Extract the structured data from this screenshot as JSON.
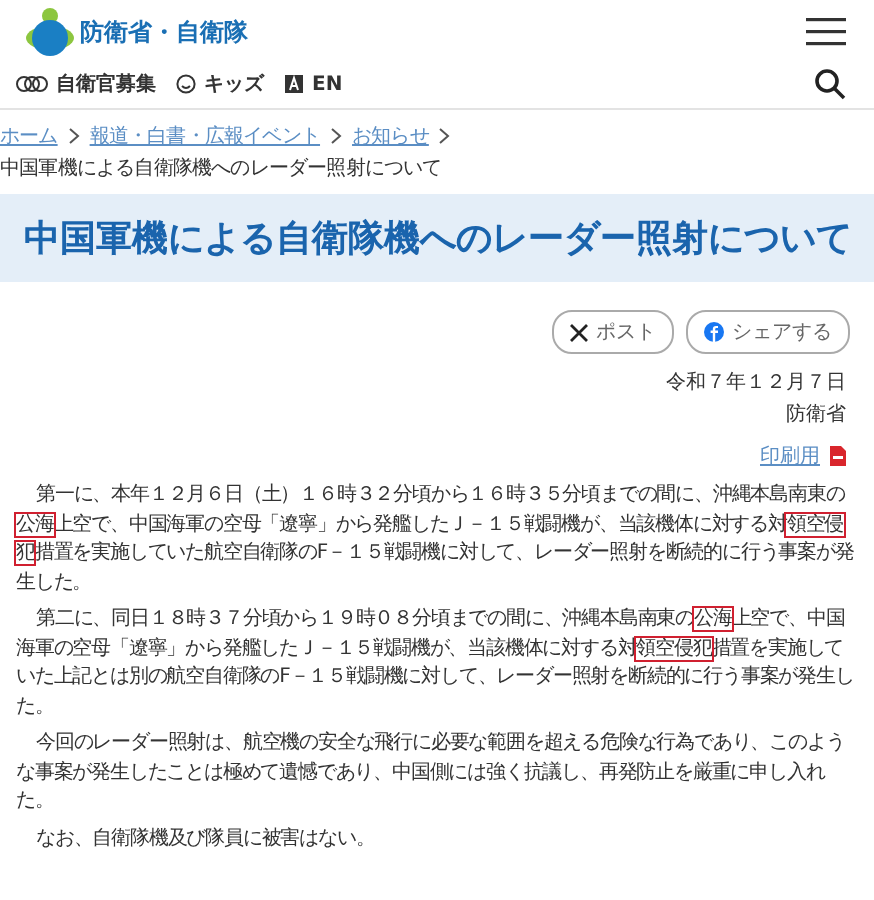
{
  "header": {
    "site_name": "防衛省・自衛隊",
    "links": [
      {
        "kind": "recruit",
        "label": "自衛官募集"
      },
      {
        "kind": "kids",
        "label": "キッズ"
      },
      {
        "kind": "english",
        "label": "EN"
      }
    ]
  },
  "breadcrumb": [
    {
      "label": "ホーム",
      "link": true
    },
    {
      "label": "報道・白書・広報イベント",
      "link": true
    },
    {
      "label": "お知らせ",
      "link": true
    },
    {
      "label": "中国軍機による自衛隊機へのレーダー照射について",
      "link": false
    }
  ],
  "title": "中国軍機による自衛隊機へのレーダー照射について",
  "share": [
    {
      "kind": "x",
      "label": "ポスト"
    },
    {
      "kind": "facebook",
      "label": "シェアする"
    }
  ],
  "date": "令和７年１２月７日",
  "author": "防衛省",
  "print_link": "印刷用",
  "paragraphs": [
    [
      {
        "text": "第一に、本年１２月６日（土）１６時３２分頃から１６時３５分頃までの間に、沖縄本島南東の",
        "boxed": false
      },
      {
        "text": "公海",
        "boxed": true
      },
      {
        "text": "上空で、中国海軍の空母「遼寧」から発艦したＪ－１５戦闘機が、当該機体に対する対",
        "boxed": false
      },
      {
        "text": "領空侵犯",
        "boxed": true
      },
      {
        "text": "措置を実施していた航空自衛隊のF－１５戦闘機に対して、レーダー照射を断続的に行う事案が発生した。",
        "boxed": false
      }
    ],
    [
      {
        "text": "第二に、同日１８時３７分頃から１９時０８分頃までの間に、沖縄本島南東の",
        "boxed": false
      },
      {
        "text": "公海",
        "boxed": true
      },
      {
        "text": "上空で、中国海軍の空母「遼寧」から発艦したＪ－１５戦闘機が、当該機体に対する対",
        "boxed": false
      },
      {
        "text": "領空侵犯",
        "boxed": true
      },
      {
        "text": "措置を実施していた上記とは別の航空自衛隊のF－１５戦闘機に対して、レーダー照射を断続的に行う事案が発生した。",
        "boxed": false
      }
    ],
    [
      {
        "text": "今回のレーダー照射は、航空機の安全な飛行に必要な範囲を超える危険な行為であり、このような事案が発生したことは極めて遺憾であり、中国側には強く抗議し、再発防止を厳重に申し入れた。",
        "boxed": false
      }
    ],
    [
      {
        "text": "なお、自衛隊機及び隊員に被害はない。",
        "boxed": false
      }
    ]
  ]
}
